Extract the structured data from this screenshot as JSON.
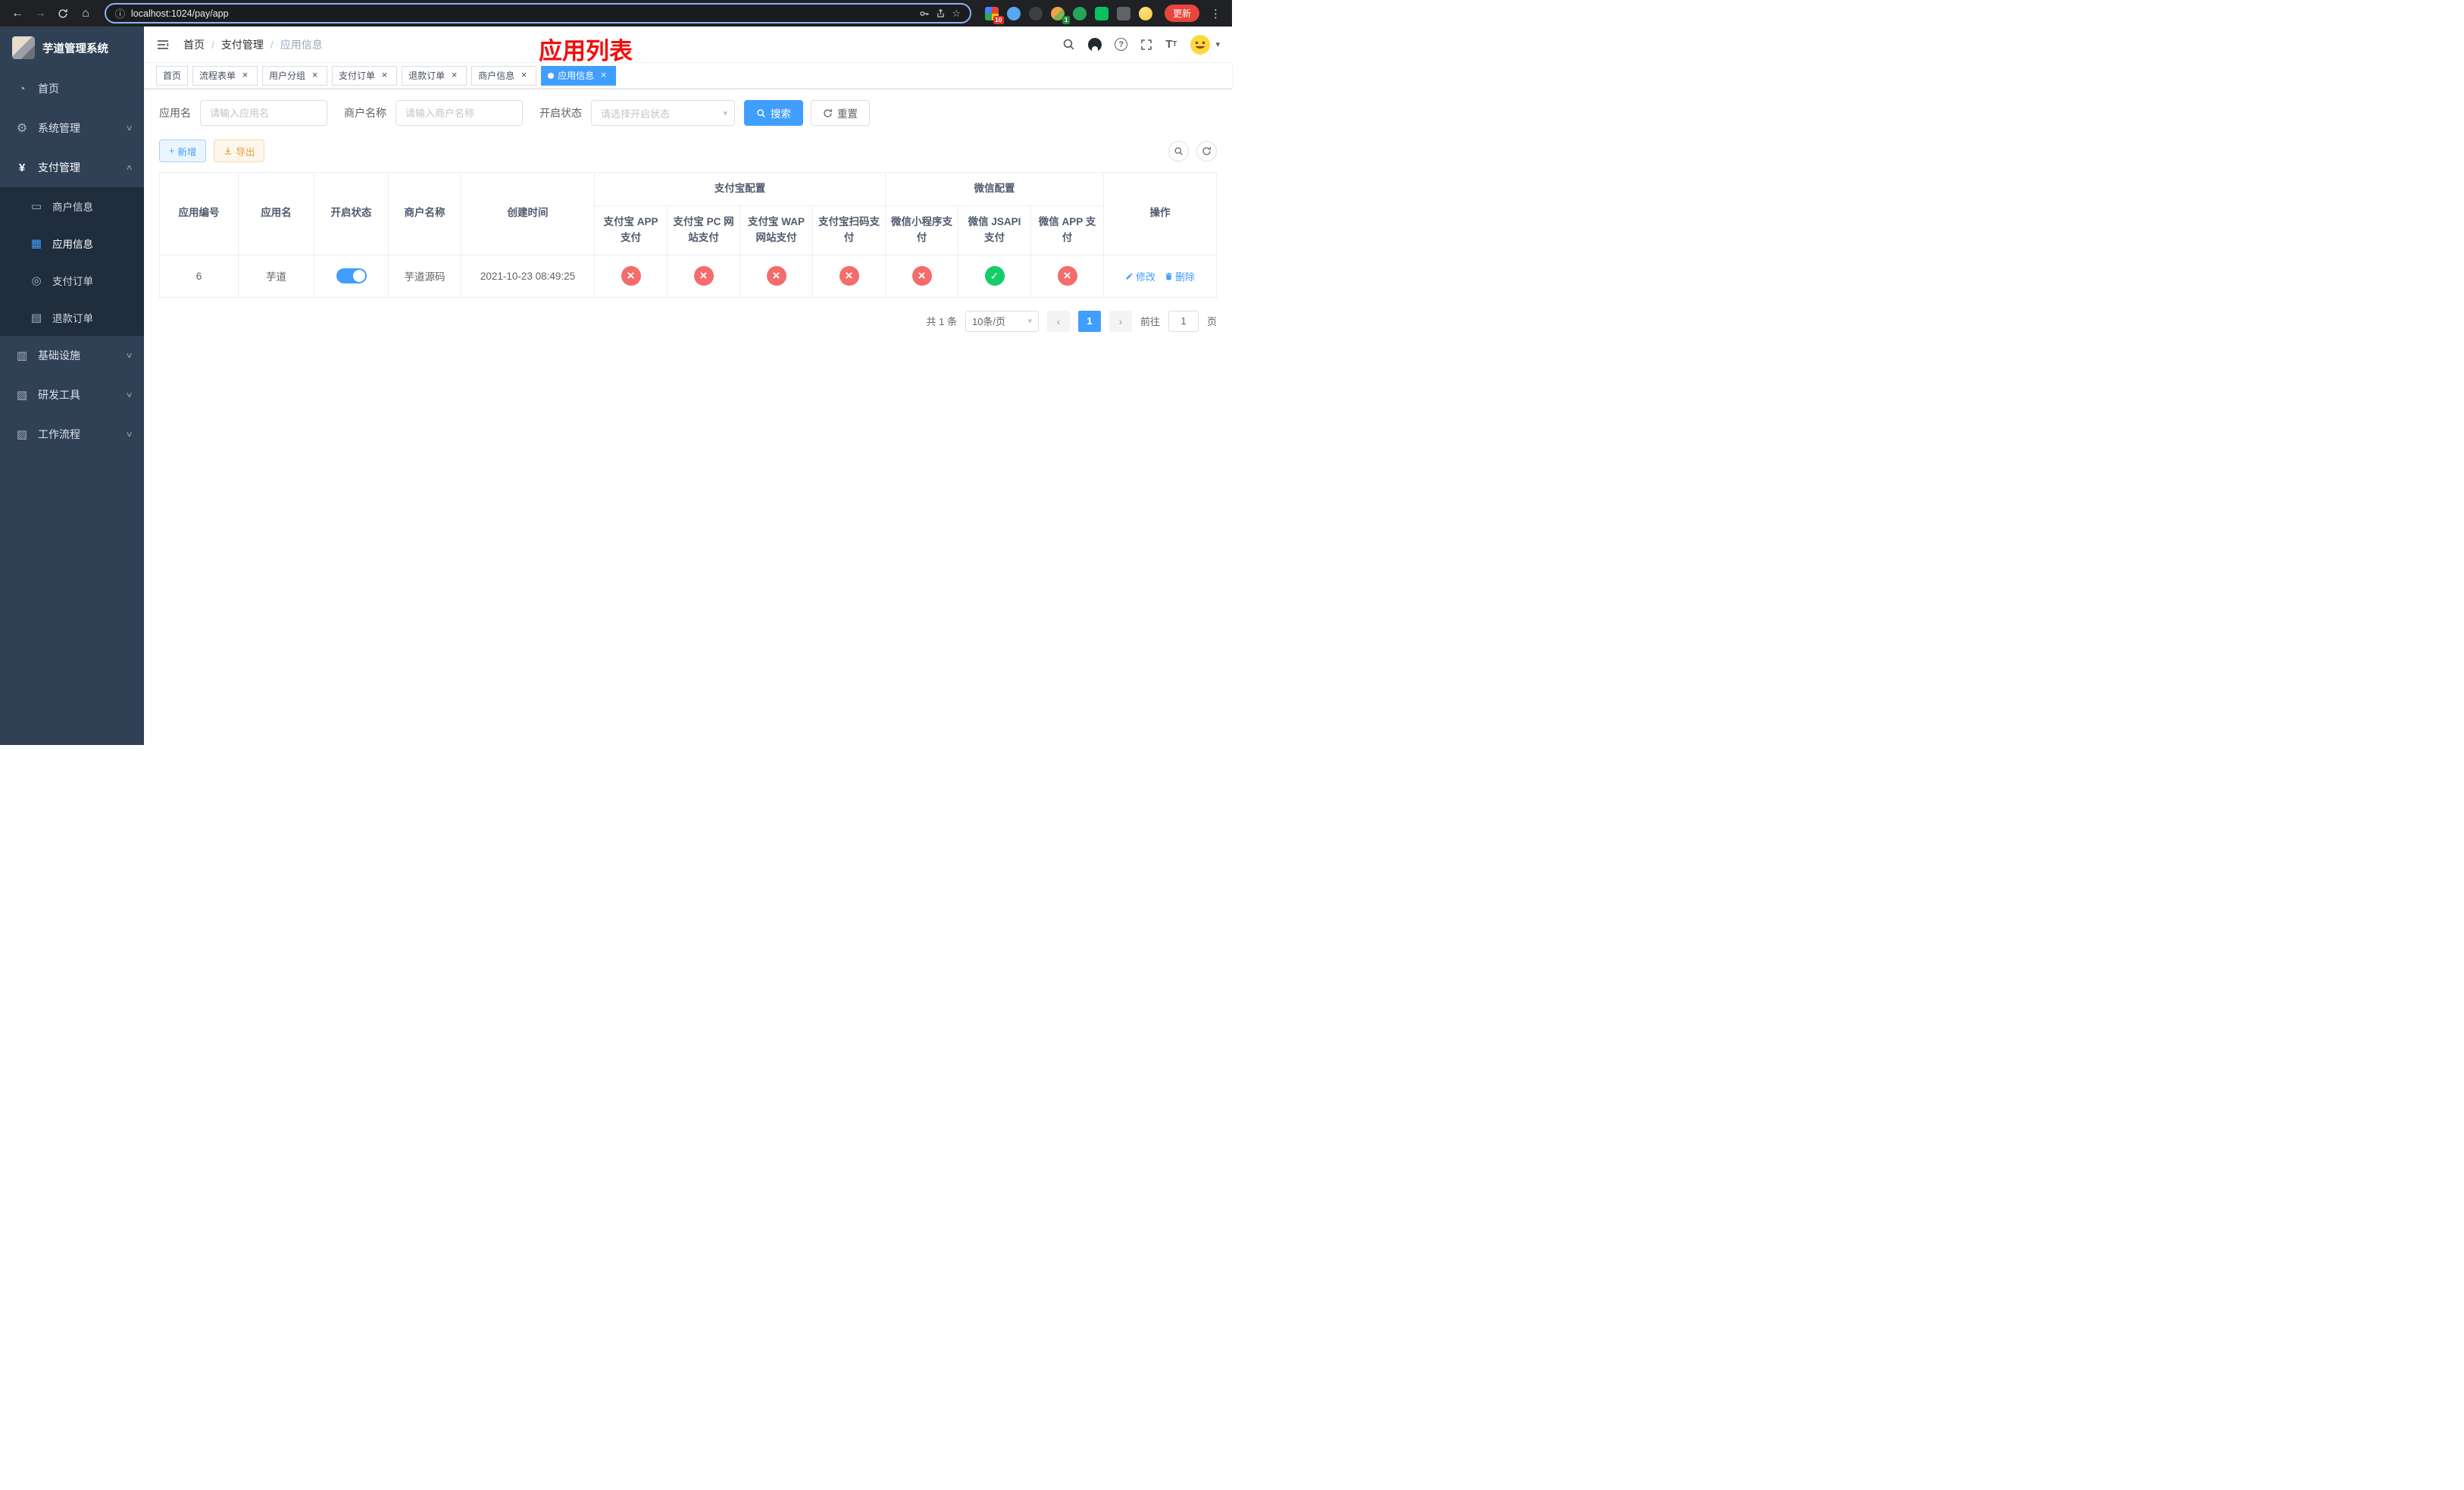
{
  "browser": {
    "url": "localhost:1024/pay/app",
    "update_label": "更新",
    "ext_badge_count": "10",
    "ext_avatar_badge": "1"
  },
  "icons": {
    "back": "←",
    "forward": "→",
    "home": "⌂",
    "info": "ⓘ",
    "star": "☆",
    "dots": "⋮",
    "caret_down": "▾",
    "chevron_down": "∨",
    "chevron_up": "∧",
    "close": "×",
    "prev": "‹",
    "next": "›",
    "plus": "+",
    "question": "?"
  },
  "colors": {
    "primary": "#409eff",
    "success": "#13ce66",
    "danger": "#f56c6c",
    "warning": "#e6a23c",
    "title_red": "#f20d0d",
    "sidebar_bg": "#304156",
    "submenu_bg": "#1f2d3d"
  },
  "sidebar": {
    "title": "芋道管理系统",
    "items": [
      {
        "label": "首页"
      },
      {
        "label": "系统管理"
      },
      {
        "label": "支付管理",
        "children": [
          {
            "label": "商户信息"
          },
          {
            "label": "应用信息"
          },
          {
            "label": "支付订单"
          },
          {
            "label": "退款订单"
          }
        ]
      },
      {
        "label": "基础设施"
      },
      {
        "label": "研发工具"
      },
      {
        "label": "工作流程"
      }
    ]
  },
  "header": {
    "breadcrumb": [
      {
        "label": "首页"
      },
      {
        "label": "支付管理"
      },
      {
        "label": "应用信息"
      }
    ],
    "separator": "/",
    "page_title": "应用列表",
    "font_size_big": "T",
    "font_size_small": "T"
  },
  "tabs": [
    {
      "label": "首页"
    },
    {
      "label": "流程表单"
    },
    {
      "label": "用户分组"
    },
    {
      "label": "支付订单"
    },
    {
      "label": "退款订单"
    },
    {
      "label": "商户信息"
    },
    {
      "label": "应用信息"
    }
  ],
  "filters": {
    "app_name_label": "应用名",
    "app_name_placeholder": "请输入应用名",
    "merchant_label": "商户名称",
    "merchant_placeholder": "请输入商户名称",
    "status_label": "开启状态",
    "status_placeholder": "请选择开启状态",
    "search_label": "搜索",
    "reset_label": "重置"
  },
  "toolbar": {
    "add_label": "新增",
    "export_label": "导出"
  },
  "table": {
    "group_headers": {
      "alipay": "支付宝配置",
      "wechat": "微信配置"
    },
    "columns": [
      "应用编号",
      "应用名",
      "开启状态",
      "商户名称",
      "创建时间",
      "支付宝 APP 支付",
      "支付宝 PC 网站支付",
      "支付宝 WAP 网站支付",
      "支付宝扫码支付",
      "微信小程序支付",
      "微信 JSAPI 支付",
      "微信 APP 支付",
      "操作"
    ],
    "rows": [
      {
        "id": "6",
        "name": "芋道",
        "enabled": true,
        "merchant": "芋道源码",
        "created": "2021-10-23 08:49:25",
        "alipay_app": false,
        "alipay_pc": false,
        "alipay_wap": false,
        "alipay_qr": false,
        "wx_mini": false,
        "wx_jsapi": true,
        "wx_app": false,
        "edit_label": "修改",
        "delete_label": "删除"
      }
    ]
  },
  "pagination": {
    "total": "共 1 条",
    "page_size": "10条/页",
    "current_page": "1",
    "goto_label": "前往",
    "goto_value": "1",
    "page_label": "页"
  }
}
